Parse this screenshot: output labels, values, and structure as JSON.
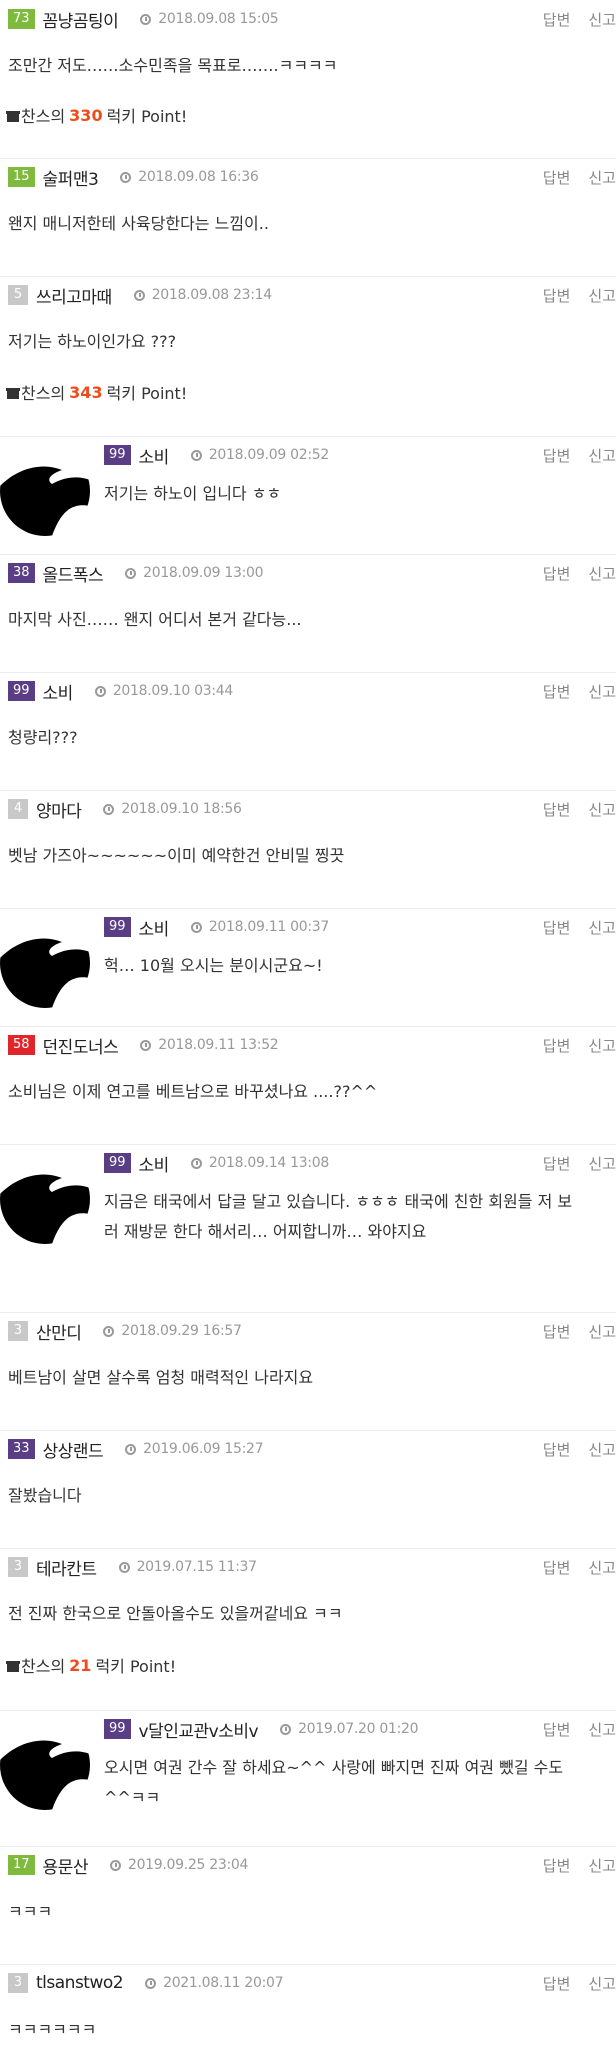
{
  "ui": {
    "reply_label": "답변",
    "report_label": "신고",
    "lucky_prefix": "찬스의",
    "lucky_suffix": "럭키 Point!"
  },
  "colors": {
    "level_green": "#7fb93d",
    "level_purple": "#5a3e85",
    "level_gray": "#c8c8c8",
    "level_red": "#e0262a",
    "lucky_number": "#f04b1c"
  },
  "comments": [
    {
      "level": "73",
      "nickname": "꼼냥곰팅이",
      "time": "2018.09.08 15:05",
      "text": "조만간 저도……소수민족을 목표로…….ㅋㅋㅋㅋ",
      "lucky": "330"
    },
    {
      "level": "15",
      "nickname": "술퍼맨3",
      "time": "2018.09.08 16:36",
      "text": "왠지 매니저한테 사육당한다는 느낌이.."
    },
    {
      "level": "5",
      "nickname": "쓰리고마때",
      "time": "2018.09.08 23:14",
      "text": "저기는 하노이인가요 ???",
      "lucky": "343"
    },
    {
      "level": "99",
      "nickname": "소비",
      "time": "2018.09.09 02:52",
      "text": "저기는 하노이 입니다 ㅎㅎ",
      "reply": true
    },
    {
      "level": "38",
      "nickname": "올드폭스",
      "time": "2018.09.09 13:00",
      "text": "마지막 사진…… 왠지 어디서 본거 같다능..."
    },
    {
      "level": "99",
      "nickname": "소비",
      "time": "2018.09.10 03:44",
      "text": "청량리???"
    },
    {
      "level": "4",
      "nickname": "양마다",
      "time": "2018.09.10 18:56",
      "text": "벳남 가즈아~~~~~~이미 예약한건 안비밀 찡끗"
    },
    {
      "level": "99",
      "nickname": "소비",
      "time": "2018.09.11 00:37",
      "text": "헉… 10월 오시는 분이시군요~!",
      "reply": true
    },
    {
      "level": "58",
      "nickname": "던진도너스",
      "time": "2018.09.11 13:52",
      "text": "소비님은 이제 연고를 베트남으로 바꾸셨나요 ....??^^"
    },
    {
      "level": "99",
      "nickname": "소비",
      "time": "2018.09.14 13:08",
      "text": "지금은 태국에서 답글 달고 있습니다. ㅎㅎㅎ 태국에 친한 회원들 저 보러 재방문 한다 해서리… 어찌합니까… 와야지요",
      "reply": true
    },
    {
      "level": "3",
      "nickname": "산만디",
      "time": "2018.09.29 16:57",
      "text": "베트남이 살면 살수록 엄청 매력적인 나라지요"
    },
    {
      "level": "33",
      "nickname": "상상랜드",
      "time": "2019.06.09 15:27",
      "text": "잘봤습니다"
    },
    {
      "level": "3",
      "nickname": "테라칸트",
      "time": "2019.07.15 11:37",
      "text": "전 진짜 한국으로 안돌아올수도 있을꺼같네요 ㅋㅋ",
      "lucky": "21"
    },
    {
      "level": "99",
      "nickname": "v달인교관v소비v",
      "time": "2019.07.20 01:20",
      "text": "오시면 여권 간수 잘 하세요~^^ 사랑에 빠지면 진짜 여권 뺐길 수도^^ㅋㅋ",
      "reply": true
    },
    {
      "level": "17",
      "nickname": "용문산",
      "time": "2019.09.25 23:04",
      "text": "ㅋㅋㅋ"
    },
    {
      "level": "3",
      "nickname": "tlsanstwo2",
      "time": "2021.08.11 20:07",
      "text": "ㅋㅋㅋㅋㅋㅋ"
    }
  ]
}
